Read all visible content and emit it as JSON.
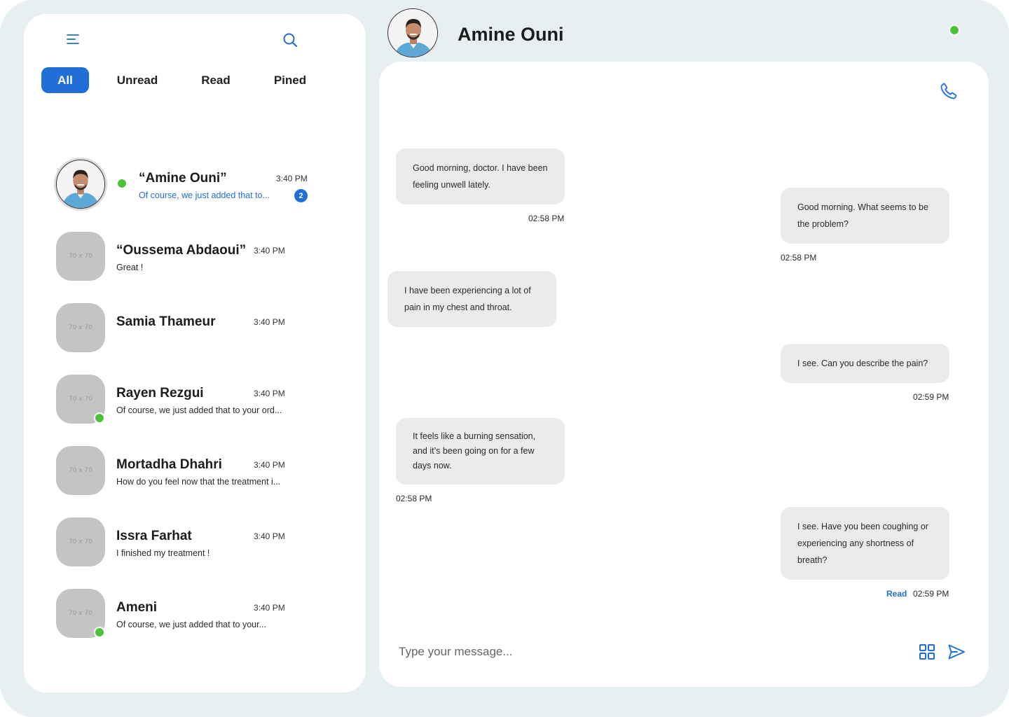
{
  "sidebar": {
    "tabs": [
      {
        "label": "All",
        "active": true
      },
      {
        "label": "Unread",
        "active": false
      },
      {
        "label": "Read",
        "active": false
      },
      {
        "label": "Pined",
        "active": false
      }
    ],
    "conversations": [
      {
        "name": "“Amine Ouni”",
        "time": "3:40 PM",
        "preview": "Of course, we just added that to...",
        "unread": "2",
        "online": true,
        "active": true
      },
      {
        "name": "“Oussema Abdaoui”",
        "time": "3:40 PM",
        "preview": "Great !",
        "placeholder": "70 x 70",
        "online": false
      },
      {
        "name": "Samia Thameur",
        "time": "3:40 PM",
        "preview": "",
        "placeholder": "70 x 70",
        "online": false
      },
      {
        "name": "Rayen Rezgui",
        "time": "3:40 PM",
        "preview": "Of course, we just added that to your ord...",
        "placeholder": "70 x 70",
        "online": true
      },
      {
        "name": "Mortadha Dhahri",
        "time": "3:40 PM",
        "preview": "How do you feel now that the treatment i...",
        "placeholder": "70 x 70",
        "online": false
      },
      {
        "name": "Issra Farhat",
        "time": "3:40 PM",
        "preview": "I finished my treatment !",
        "placeholder": "70 x 70",
        "online": false
      },
      {
        "name": "Ameni",
        "time": "3:40 PM",
        "preview": "Of course, we just added that to your...",
        "placeholder": "70 x 70",
        "online": true
      }
    ]
  },
  "chat": {
    "contact_name": "Amine Ouni",
    "online": true,
    "messages": [
      {
        "from": "patient",
        "text": "Good morning, doctor. I have been feeling unwell lately.",
        "time": "02:58 PM"
      },
      {
        "from": "doctor",
        "text": "Good morning. What seems to be the problem?",
        "time": "02:58 PM"
      },
      {
        "from": "patient",
        "text": "I have been experiencing a lot of pain in my chest and throat.",
        "time": ""
      },
      {
        "from": "doctor",
        "text": "I see. Can you describe the pain?",
        "time": "02:59 PM"
      },
      {
        "from": "patient",
        "text": "It feels like a burning sensation, and it’s been going on for a few days now.",
        "time": "02:58 PM"
      },
      {
        "from": "doctor",
        "text": "I see. Have you been coughing or experiencing any shortness of breath?",
        "time": "02:59 PM",
        "status": "Read"
      }
    ],
    "composer_placeholder": "Type your message..."
  },
  "colors": {
    "accent": "#1f6fd6",
    "online": "#4cc23a",
    "frame": "#e8eff2",
    "bubble": "#ebebeb"
  },
  "icons": [
    "menu-icon",
    "search-icon",
    "phone-icon",
    "grid-icon",
    "send-icon"
  ]
}
